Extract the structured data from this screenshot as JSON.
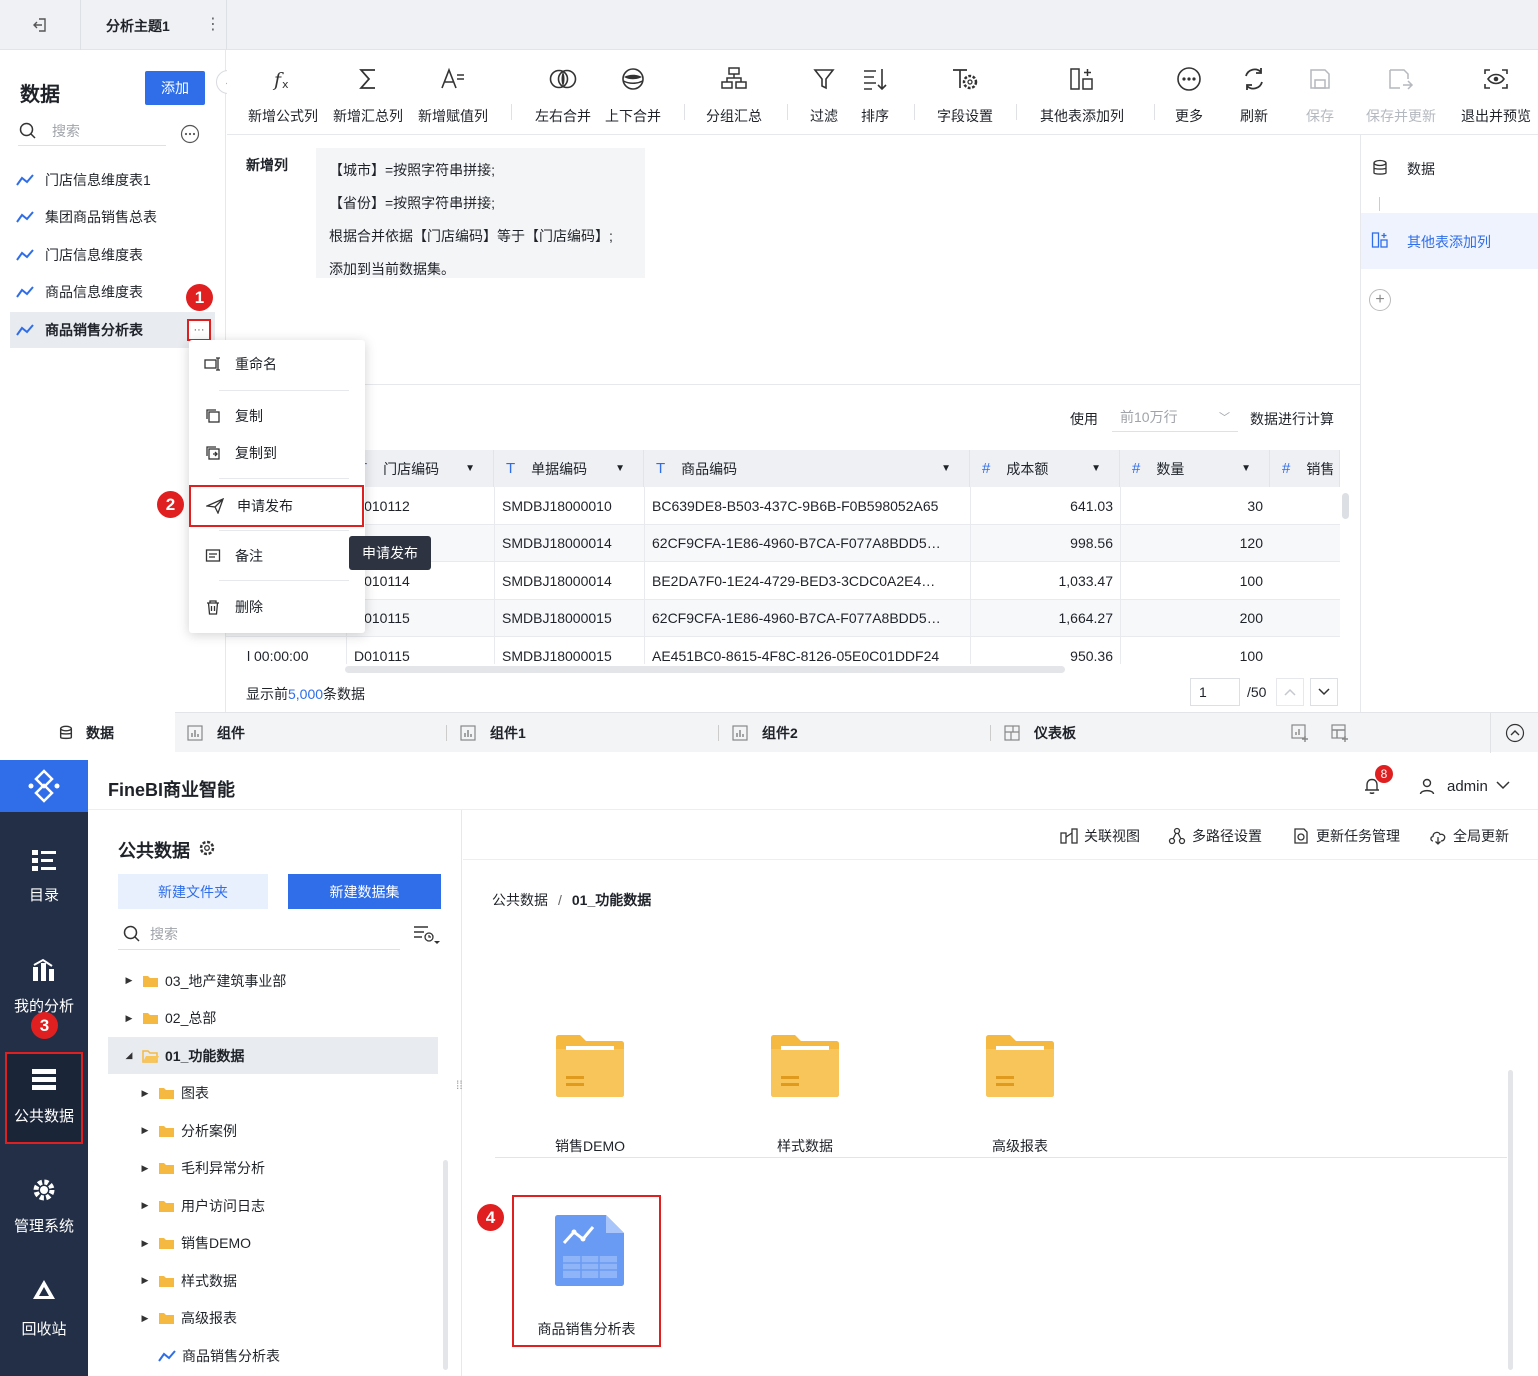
{
  "top": {
    "tab_title": "分析主题1",
    "data_panel": {
      "title": "数据",
      "add_label": "添加",
      "search_placeholder": "搜索",
      "items": [
        "门店信息维度表1",
        "集团商品销售总表",
        "门店信息维度表",
        "商品信息维度表",
        "商品销售分析表"
      ]
    },
    "toolbar": [
      {
        "label": "新增公式列",
        "icon": "formula-icon"
      },
      {
        "label": "新增汇总列",
        "icon": "sigma-icon"
      },
      {
        "label": "新增赋值列",
        "icon": "assign-icon"
      },
      {
        "label": "左右合并",
        "icon": "merge-lr-icon"
      },
      {
        "label": "上下合并",
        "icon": "merge-ud-icon"
      },
      {
        "label": "分组汇总",
        "icon": "group-icon"
      },
      {
        "label": "过滤",
        "icon": "filter-icon"
      },
      {
        "label": "排序",
        "icon": "sort-icon"
      },
      {
        "label": "字段设置",
        "icon": "field-settings-icon"
      },
      {
        "label": "其他表添加列",
        "icon": "add-column-icon"
      },
      {
        "label": "更多",
        "icon": "more-icon"
      },
      {
        "label": "刷新",
        "icon": "refresh-icon"
      },
      {
        "label": "保存",
        "icon": "save-icon",
        "disabled": true
      },
      {
        "label": "保存并更新",
        "icon": "save-update-icon",
        "disabled": true
      },
      {
        "label": "退出并预览",
        "icon": "preview-icon"
      }
    ],
    "step_title": "新增列",
    "step_lines": [
      "【城市】=按照字符串拼接;",
      "【省份】=按照字符串拼接;",
      "根据合并依据【门店编码】等于【门店编码】;",
      "添加到当前数据集。"
    ],
    "right_steps": [
      "数据",
      "其他表添加列"
    ],
    "use_label": "使用",
    "row_select": "前10万行",
    "calc_label": "数据进行计算",
    "table": {
      "headers": [
        "门店编码",
        "单据编码",
        "商品编码",
        "成本额",
        "数量",
        "销售"
      ],
      "header_types": [
        "T",
        "T",
        "T",
        "#",
        "#",
        "#"
      ],
      "rows": [
        [
          "",
          "D010112",
          "SMDBJ18000010",
          "BC639DE8-B503-437C-9B6B-F0B598052A65",
          "641.03",
          "30"
        ],
        [
          "",
          "",
          "SMDBJ18000014",
          "62CF9CFA-1E86-4960-B7CA-F077A8BDD5…",
          "998.56",
          "120"
        ],
        [
          "",
          "D010114",
          "SMDBJ18000014",
          "BE2DA7F0-1E24-4729-BED3-3CDC0A2E4…",
          "1,033.47",
          "100"
        ],
        [
          "",
          "D010115",
          "SMDBJ18000015",
          "62CF9CFA-1E86-4960-B7CA-F077A8BDD5…",
          "1,664.27",
          "200"
        ],
        [
          "l 00:00:00",
          "D010115",
          "SMDBJ18000015",
          "AE451BC0-8615-4F8C-8126-05E0C01DDF24",
          "950.36",
          "100"
        ]
      ]
    },
    "footer_prefix": "显示前",
    "footer_count": "5,000",
    "footer_suffix": "条数据",
    "page_current": "1",
    "page_total": "/50",
    "context_menu": [
      "重命名",
      "复制",
      "复制到",
      "申请发布",
      "备注",
      "删除"
    ],
    "tooltip": "申请发布",
    "bottom_tabs": [
      "数据",
      "组件",
      "组件1",
      "组件2",
      "仪表板"
    ],
    "badges": [
      "1",
      "2",
      "3",
      "4"
    ]
  },
  "bottom": {
    "brand": "FineBI商业智能",
    "notify_count": "8",
    "user": "admin",
    "nav": [
      "目录",
      "我的分析",
      "公共数据",
      "管理系统",
      "回收站"
    ],
    "panel_title": "公共数据",
    "new_folder": "新建文件夹",
    "new_dataset": "新建数据集",
    "search_placeholder": "搜索",
    "tree": [
      {
        "label": "03_地产建筑事业部",
        "level": 0,
        "kind": "folder",
        "expanded": false
      },
      {
        "label": "02_总部",
        "level": 0,
        "kind": "folder",
        "expanded": false
      },
      {
        "label": "01_功能数据",
        "level": 0,
        "kind": "folder",
        "expanded": true,
        "selected": true
      },
      {
        "label": "图表",
        "level": 1,
        "kind": "folder"
      },
      {
        "label": "分析案例",
        "level": 1,
        "kind": "folder"
      },
      {
        "label": "毛利异常分析",
        "level": 1,
        "kind": "folder"
      },
      {
        "label": "用户访问日志",
        "level": 1,
        "kind": "folder"
      },
      {
        "label": "销售DEMO",
        "level": 1,
        "kind": "folder"
      },
      {
        "label": "样式数据",
        "level": 1,
        "kind": "folder"
      },
      {
        "label": "高级报表",
        "level": 1,
        "kind": "folder"
      },
      {
        "label": "商品销售分析表",
        "level": 1,
        "kind": "dataset"
      }
    ],
    "header_actions": [
      "关联视图",
      "多路径设置",
      "更新任务管理",
      "全局更新"
    ],
    "breadcrumb": [
      "公共数据",
      "01_功能数据"
    ],
    "folders": [
      "销售DEMO",
      "样式数据",
      "高级报表"
    ],
    "dataset_card": "商品销售分析表"
  },
  "colors": {
    "accent": "#2f6ee8",
    "badge": "#e02020",
    "nav_bg": "#232f46",
    "folder": "#f5b942"
  }
}
